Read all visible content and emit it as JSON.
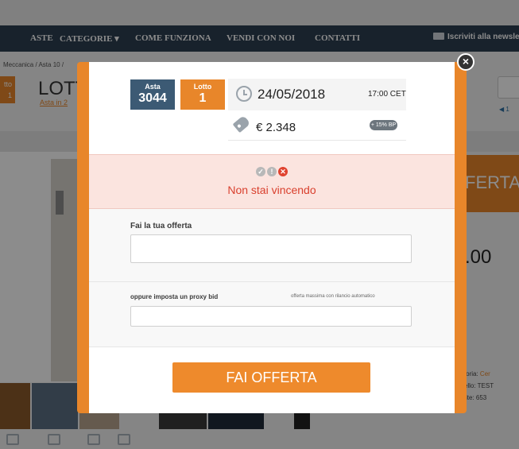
{
  "nav": {
    "items": [
      "ASTE",
      "CATEGORIE ▾",
      "COME FUNZIONA",
      "VENDI CON NOI",
      "CONTATTI"
    ],
    "newsletter": "Iscriviti alla newsletter"
  },
  "background": {
    "breadcrumb": "Meccanica / Asta 10 /",
    "lot_badge": "tto\n1",
    "lot_title": "LOTT",
    "lot_link": "Asta in 2",
    "right_link": "◀ 1",
    "offer_tab": "FERTA",
    "amount": ".00",
    "meta": [
      {
        "label": "tegoria:",
        "value": "Cer"
      },
      {
        "label": "odello:",
        "value": "TEST"
      },
      {
        "label": "Visite:",
        "value": "653"
      }
    ],
    "colors": {
      "accent": "#e8862a",
      "nav": "#2c3e50"
    }
  },
  "modal": {
    "close_icon": "×",
    "asta": {
      "label": "Asta",
      "value": "3044"
    },
    "lotto": {
      "label": "Lotto",
      "value": "1"
    },
    "date": "24/05/2018",
    "time": "17:00 CET",
    "price": "€ 2.348",
    "bp_badge": "+ 15% BP",
    "status": {
      "icons": [
        "check-icon",
        "exclamation-icon",
        "x-icon"
      ],
      "text": "Non stai vincendo"
    },
    "offer_label": "Fai la tua offerta",
    "offer_placeholder": "",
    "proxy_label": "oppure imposta un proxy bid",
    "proxy_hint": "offerta massima con rilancio automatico",
    "proxy_placeholder": "",
    "submit_label": "FAI OFFERTA",
    "colors": {
      "orange": "#e8862a",
      "blue": "#3c5a74",
      "error": "#d9402e",
      "error_bg": "#fbe4df"
    }
  }
}
